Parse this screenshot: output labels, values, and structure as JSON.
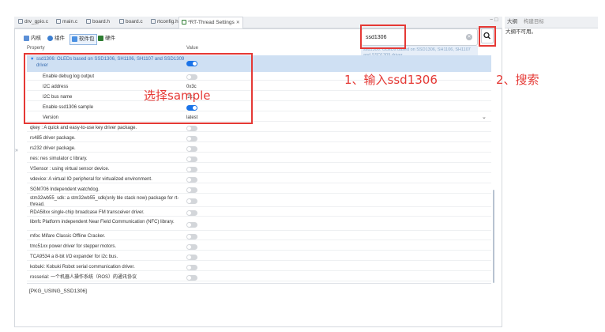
{
  "tabs": [
    {
      "label": "drv_gpio.c",
      "active": false
    },
    {
      "label": "main.c",
      "active": false
    },
    {
      "label": "board.h",
      "active": false
    },
    {
      "label": "board.c",
      "active": false
    },
    {
      "label": "rtconfig.h",
      "active": false
    },
    {
      "label": "*RT-Thread Settings",
      "active": true
    }
  ],
  "window_controls": "− □",
  "right_panel": {
    "title": "大纲",
    "title2": "构建目标",
    "body": "大纲不可用。"
  },
  "toolbar": {
    "items": [
      {
        "label": "内核",
        "active": false
      },
      {
        "label": "组件",
        "active": false
      },
      {
        "label": "软件包",
        "active": true
      },
      {
        "label": "硬件",
        "active": false
      }
    ]
  },
  "search": {
    "value": "ssd1306",
    "suggestion": "ssd1306: OLEDs based on SSD1306, SH1106, SH1107 and SSD1309 driver"
  },
  "table": {
    "headers": {
      "property": "Property",
      "value": "Value"
    },
    "package_row": {
      "label": "ssd1306: OLEDs based on SSD1306, SH1106, SH1107 and SSD1309 driver",
      "enabled": true
    },
    "sub_rows": [
      {
        "label": "Enable debug log output",
        "kind": "toggle",
        "on": false
      },
      {
        "label": "I2C address",
        "kind": "text",
        "value": "0x3c"
      },
      {
        "label": "I2C bus name",
        "kind": "text",
        "value": "i2c1"
      },
      {
        "label": "Enable ssd1306 sample",
        "kind": "toggle",
        "on": true
      },
      {
        "label": "Version",
        "kind": "select",
        "value": "latest"
      }
    ],
    "package_list": [
      {
        "label": "qkey : A quick and easy-to-use key driver package.",
        "on": false
      },
      {
        "label": "rs485 driver package.",
        "on": false
      },
      {
        "label": "rs232 driver package.",
        "on": false
      },
      {
        "label": "nes: nes simulator c library.",
        "on": false
      },
      {
        "label": "VSensor : using virtual sensor device.",
        "on": false
      },
      {
        "label": "vdevice: A virtual IO peripheral for virtualized environment.",
        "on": false
      },
      {
        "label": "SGM706 Independent watchdog.",
        "on": false
      },
      {
        "label": "stm32wb55_sdk: a stm32wb55_sdk(only ble stack now) package for rt-thread.",
        "on": false
      },
      {
        "label": "RDA58xx single-chip broadcase FM transceiver driver.",
        "on": false
      },
      {
        "label": "libnfc Platform independent Near Field Communication (NFC) library.",
        "on": false
      },
      {
        "label": "mfoc Mifare Classic Offline Cracker.",
        "on": false
      },
      {
        "label": "tmc51xx power driver for stepper motors.",
        "on": false
      },
      {
        "label": "TCA9534 a 8-bit I/O expander for i2c bus.",
        "on": false
      },
      {
        "label": "kobuki: Kobuki Robot serial communication driver.",
        "on": false
      },
      {
        "label": "rosserial: 一个机器人操作系统（ROS）的通讯协议",
        "on": false
      }
    ]
  },
  "bottom_text": "[PKG_USING_SSD1306]",
  "annotations": {
    "step1": "1、输入ssd1306",
    "step2": "2、搜索",
    "select": "选择sample"
  },
  "colors": {
    "accent": "#1a73e8",
    "annotation": "#e53935",
    "selected_row": "#cfe0f3"
  }
}
